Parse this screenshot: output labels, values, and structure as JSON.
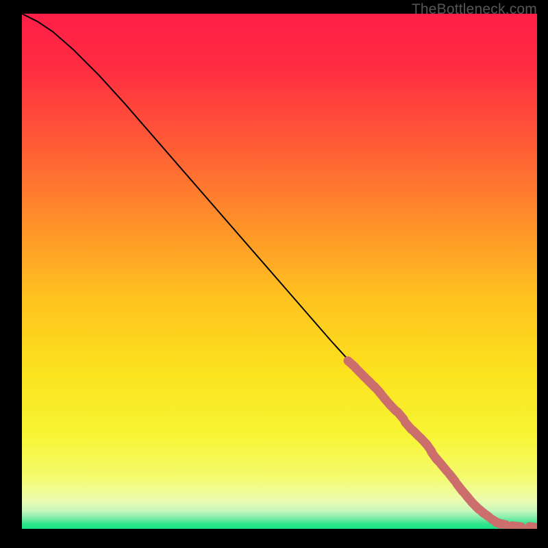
{
  "watermark": "TheBottleneck.com",
  "chart_data": {
    "type": "line",
    "title": "",
    "xlabel": "",
    "ylabel": "",
    "xlim": [
      0,
      100
    ],
    "ylim": [
      0,
      100
    ],
    "grid": false,
    "series": [
      {
        "name": "curve",
        "style": "line",
        "color": "#000000",
        "x": [
          0,
          3,
          6,
          10,
          15,
          20,
          30,
          40,
          50,
          60,
          65,
          70,
          75,
          80,
          85,
          88,
          90,
          92,
          94,
          96,
          98,
          100
        ],
        "y": [
          100,
          98.5,
          96.5,
          93,
          88,
          82.5,
          71,
          59.5,
          48,
          36.5,
          31,
          25.5,
          20,
          14,
          8,
          4.5,
          2.5,
          1.3,
          0.7,
          0.4,
          0.3,
          0.3
        ]
      },
      {
        "name": "highlighted-points",
        "style": "marker",
        "color": "#cc6e6c",
        "x": [
          64,
          65.5,
          67,
          68,
          69,
          70,
          71,
          72,
          73.5,
          75,
          76.5,
          78,
          79,
          80,
          81,
          82,
          83.5,
          85,
          86,
          87,
          88,
          89,
          90,
          92,
          93,
          96,
          99.5
        ],
        "y": [
          32,
          30.5,
          29,
          28,
          27,
          25.8,
          24.6,
          23.5,
          22,
          20,
          18.5,
          17,
          15.8,
          14.2,
          13,
          11.8,
          10,
          8,
          6.8,
          5.6,
          4.5,
          3.6,
          2.8,
          1.4,
          1.0,
          0.5,
          0.3
        ]
      }
    ],
    "background_gradient": {
      "stops": [
        {
          "pos": 0.0,
          "color": "#ff1f47"
        },
        {
          "pos": 0.1,
          "color": "#ff2b42"
        },
        {
          "pos": 0.25,
          "color": "#ff5a36"
        },
        {
          "pos": 0.4,
          "color": "#ff8e2a"
        },
        {
          "pos": 0.55,
          "color": "#ffc21f"
        },
        {
          "pos": 0.7,
          "color": "#fbe31e"
        },
        {
          "pos": 0.82,
          "color": "#f7f535"
        },
        {
          "pos": 0.9,
          "color": "#f4fb6e"
        },
        {
          "pos": 0.945,
          "color": "#ecfcb0"
        },
        {
          "pos": 0.965,
          "color": "#c7f7bc"
        },
        {
          "pos": 0.978,
          "color": "#86eeab"
        },
        {
          "pos": 0.99,
          "color": "#33e58e"
        },
        {
          "pos": 1.0,
          "color": "#16e183"
        }
      ]
    }
  }
}
